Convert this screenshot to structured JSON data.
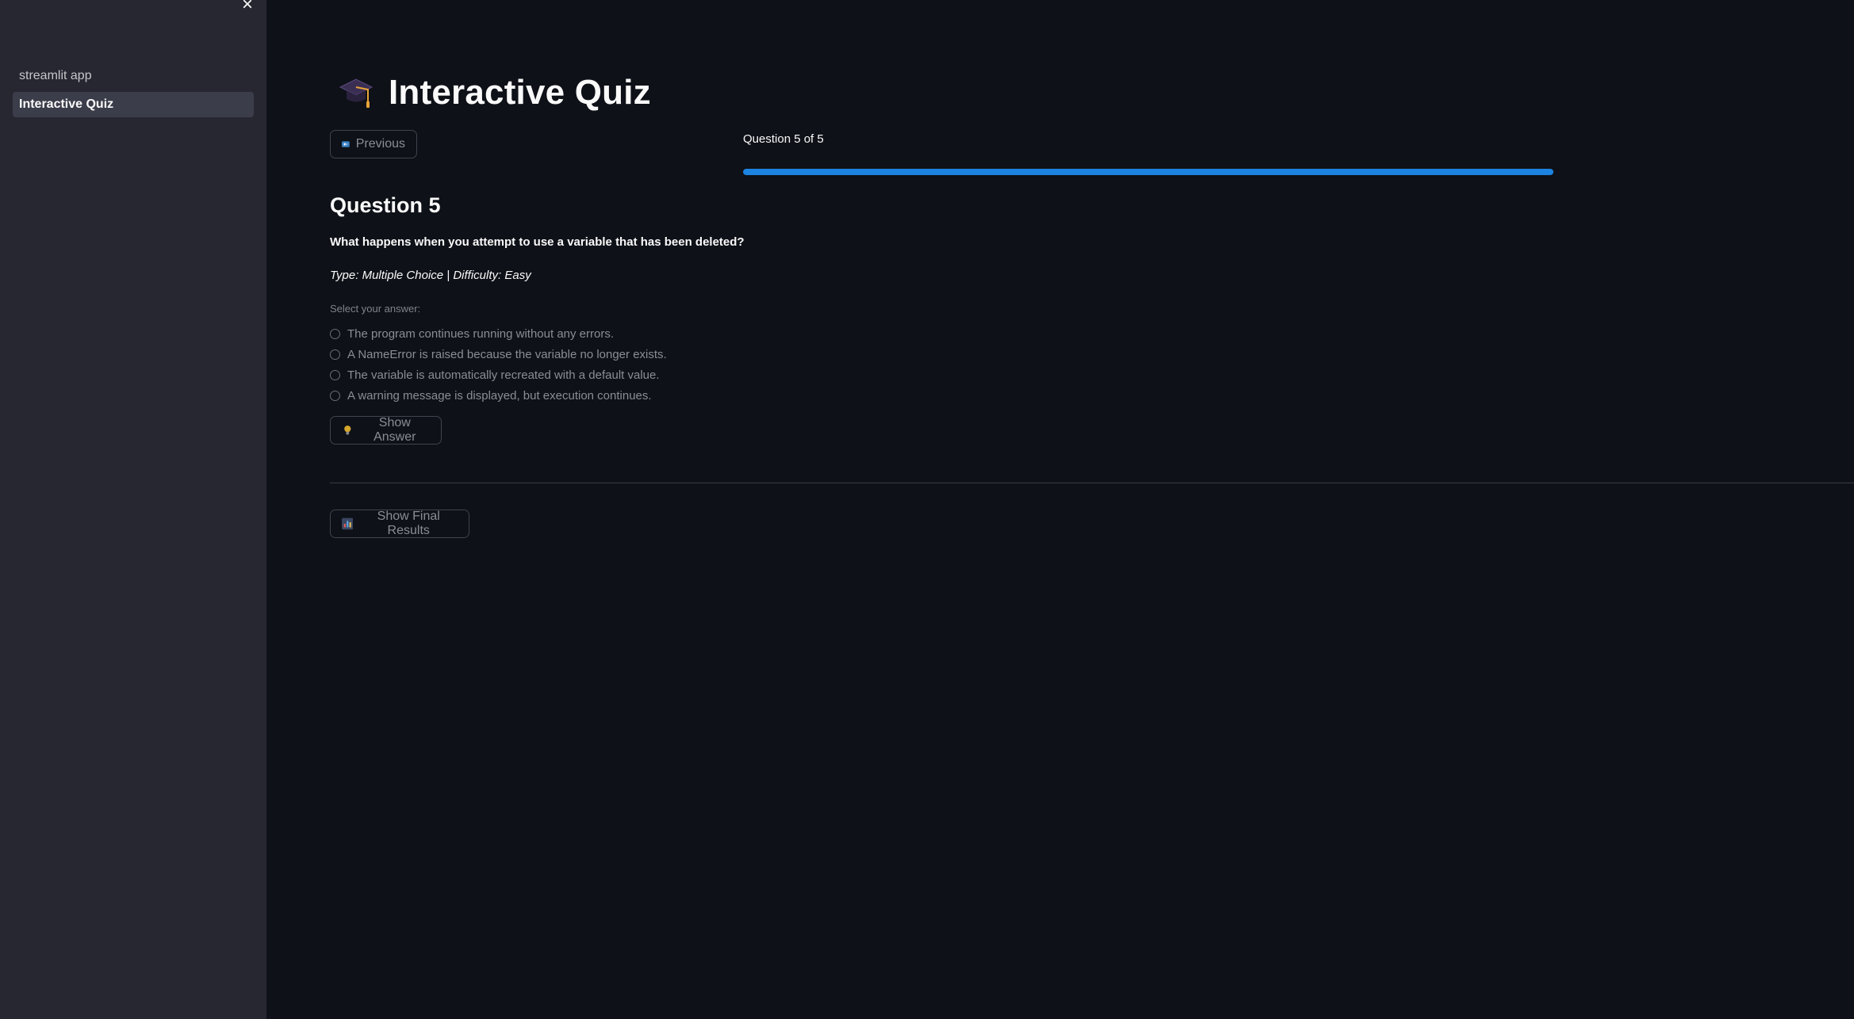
{
  "sidebar": {
    "close_label": "×",
    "items": [
      {
        "label": "streamlit app"
      },
      {
        "label": "Interactive Quiz"
      }
    ]
  },
  "main": {
    "title": "Interactive Quiz",
    "title_icon": "graduation-cap-icon",
    "previous_label": "Previous",
    "progress_label": "Question 5 of 5",
    "progress_fraction": 1.0,
    "question_heading": "Question 5",
    "question_text": "What happens when you attempt to use a variable that has been deleted?",
    "question_meta": "Type: Multiple Choice | Difficulty: Easy",
    "select_label": "Select your answer:",
    "options": [
      "The program continues running without any errors.",
      "A NameError is raised because the variable no longer exists.",
      "The variable is automatically recreated with a default value.",
      "A warning message is displayed, but execution continues."
    ],
    "show_answer_label": "Show Answer",
    "show_results_label": "Show Final Results"
  },
  "colors": {
    "accent": "#1c83e1",
    "background": "#0e1117",
    "sidebar": "#262730"
  }
}
